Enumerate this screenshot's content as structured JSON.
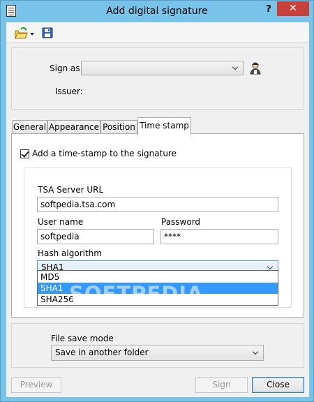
{
  "window": {
    "title": "Add digital signature",
    "help_glyph": "?",
    "close_glyph": "✕"
  },
  "toolbar": {
    "open_icon": "folder-open-icon",
    "save_icon": "floppy-disk-icon"
  },
  "signer": {
    "sign_as_label": "Sign as:",
    "sign_as_value": "",
    "issuer_label": "Issuer:",
    "certificate_icon": "certificate-person-icon"
  },
  "tabs": [
    {
      "label": "General"
    },
    {
      "label": "Appearance"
    },
    {
      "label": "Position"
    },
    {
      "label": "Time stamp"
    }
  ],
  "timestamp": {
    "checkbox_label": "Add a time-stamp to the signature",
    "checked": true,
    "tsa_url_label": "TSA Server URL",
    "tsa_url_value": "softpedia.tsa.com",
    "username_label": "User name",
    "username_value": "softpedia",
    "password_label": "Password",
    "password_value": "****",
    "hash_label": "Hash algorithm",
    "hash_value": "SHA1",
    "hash_options": [
      "MD5",
      "SHA1",
      "SHA256"
    ],
    "hash_selected_index": 1
  },
  "watermark": "SOFTPEDIA",
  "save": {
    "mode_label": "File save mode",
    "mode_value": "Save in another folder"
  },
  "buttons": {
    "preview": "Preview",
    "sign": "Sign",
    "close": "Close"
  },
  "colors": {
    "titlebar": "#78c3ea",
    "close": "#c7413a",
    "selection": "#3399ff"
  }
}
